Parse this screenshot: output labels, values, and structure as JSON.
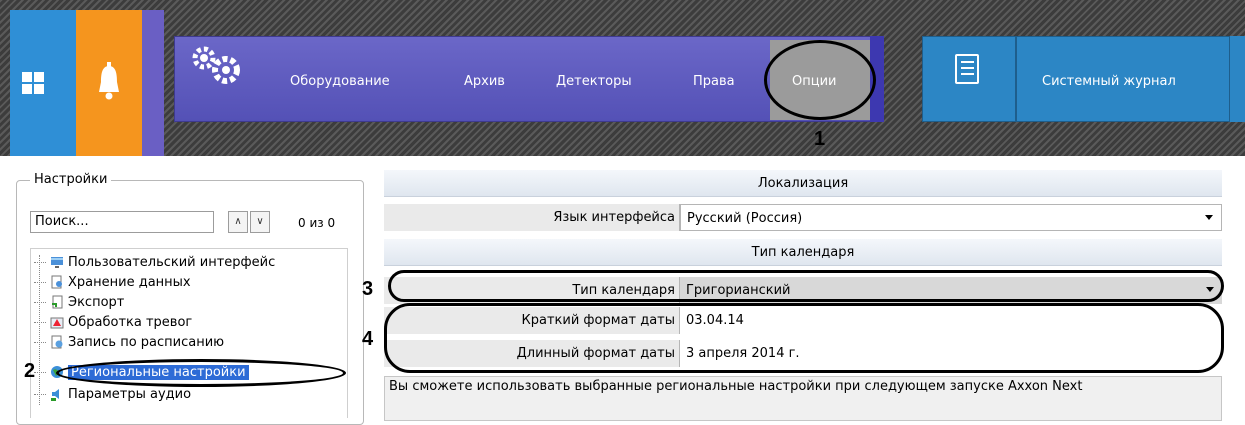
{
  "topbar": {
    "nav_items": [
      "Оборудование",
      "Архив",
      "Детекторы",
      "Права"
    ],
    "active_item": "Опции",
    "journal_label": "Системный журнал"
  },
  "callouts": [
    "1",
    "2",
    "3",
    "4"
  ],
  "settings": {
    "title": "Настройки",
    "search_placeholder": "Поиск...",
    "counter": "0 из 0",
    "tree": [
      {
        "label": "Пользовательский интерфейс",
        "icon": "monitor-icon"
      },
      {
        "label": "Хранение данных",
        "icon": "storage-icon"
      },
      {
        "label": "Экспорт",
        "icon": "export-icon"
      },
      {
        "label": "Обработка тревог",
        "icon": "alarm-icon"
      },
      {
        "label": "Запись по расписанию",
        "icon": "schedule-icon"
      },
      {
        "label": "Региональные настройки",
        "icon": "globe-icon",
        "selected": true
      },
      {
        "label": "Параметры аудио",
        "icon": "audio-icon"
      }
    ]
  },
  "main": {
    "section_localization": "Локализация",
    "language_label": "Язык интерфейса",
    "language_value": "Русский (Россия)",
    "section_calendar": "Тип календаря",
    "calendar_label": "Тип календаря",
    "calendar_value": "Григорианский",
    "short_date_label": "Краткий формат даты",
    "short_date_value": "03.04.14",
    "long_date_label": "Длинный формат даты",
    "long_date_value": "3 апреля 2014 г.",
    "description": "Вы сможете использовать выбранные региональные настройки при следующем запуске Axxon Next"
  },
  "colors": {
    "nav_purple": "#5c58bf",
    "journal_blue": "#2c86c5",
    "selection_blue": "#2d6bd6"
  }
}
